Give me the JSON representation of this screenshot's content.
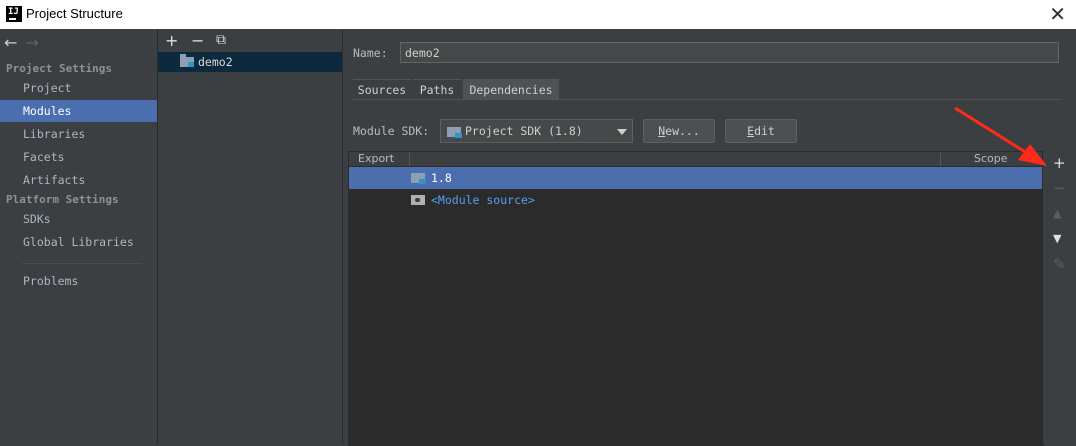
{
  "window": {
    "title": "Project Structure",
    "app_icon_text": "IJ"
  },
  "nav": {
    "back_glyph": "←",
    "forward_glyph": "→",
    "project_settings_header": "Project Settings",
    "project_items": [
      "Project",
      "Modules",
      "Libraries",
      "Facets",
      "Artifacts"
    ],
    "platform_settings_header": "Platform Settings",
    "platform_items": [
      "SDKs",
      "Global Libraries"
    ],
    "problems": "Problems",
    "selected": "Modules"
  },
  "modules": {
    "toolbar": {
      "add": "+",
      "remove": "−",
      "copy": "⧉"
    },
    "items": [
      "demo2"
    ]
  },
  "module": {
    "name_label": "Name:",
    "name_value": "demo2",
    "tabs": [
      "Sources",
      "Paths",
      "Dependencies"
    ],
    "active_tab": "Dependencies",
    "sdk_label": "Module SDK:",
    "sdk_value": "Project SDK (1.8)",
    "new_button": {
      "underlined": "N",
      "rest": "ew..."
    },
    "edit_button": {
      "underlined": "E",
      "rest": "dit"
    }
  },
  "dependencies": {
    "columns": [
      "Export",
      "Scope"
    ],
    "rows": [
      {
        "label": "1.8",
        "icon": "sdk-folder-icon",
        "selected": true
      },
      {
        "label": "<Module source>",
        "icon": "module-folder-icon",
        "selected": false
      }
    ],
    "tools": {
      "add": "+",
      "remove": "−",
      "up": "▲",
      "down": "▼",
      "edit": "✎"
    }
  },
  "colors": {
    "background": "#3c3f41",
    "selection": "#4b6eaf",
    "table_bg": "#2b2b2b",
    "link": "#589df6",
    "annotation_arrow": "#ff2a1a"
  }
}
